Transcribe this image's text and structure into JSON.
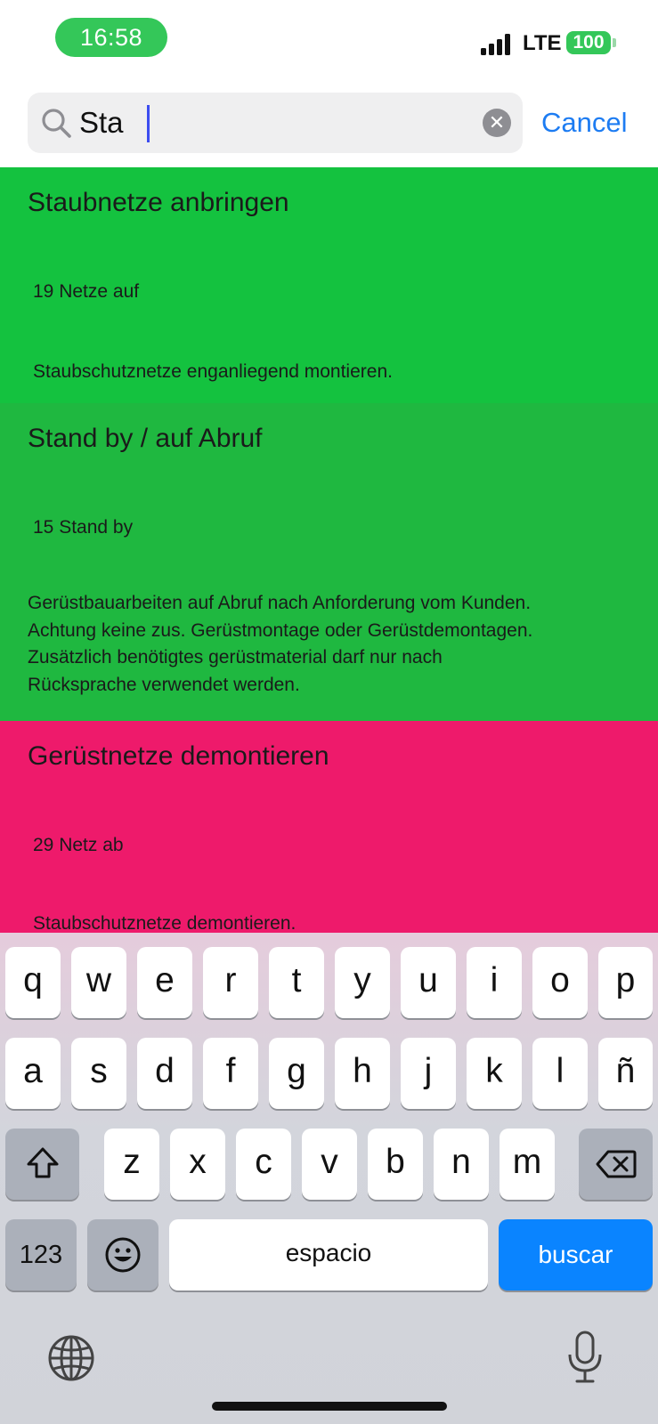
{
  "status_bar": {
    "time": "16:58",
    "network": "LTE",
    "battery": "100",
    "time_pill_color": "#34c759"
  },
  "search": {
    "query": "Sta",
    "cancel_label": "Cancel",
    "icons": [
      "search-icon",
      "clear-icon"
    ]
  },
  "results": [
    {
      "title": "Staubnetze anbringen",
      "code": "19 Netze auf",
      "description": "Staubschutznetze enganliegend montieren.",
      "color": "#14c23f"
    },
    {
      "title": "Stand by / auf Abruf",
      "code": "15 Stand by",
      "description": "Gerüstbauarbeiten auf Abruf nach Anforderung vom Kunden.\nAchtung keine zus. Gerüstmontage oder Gerüstdemontagen.\nZusätzlich benötigtes gerüstmaterial darf nur nach\nRücksprache verwendet werden.",
      "color": "#1fb840"
    },
    {
      "title": "Gerüstnetze demontieren",
      "code": "29 Netz ab",
      "description": "Staubschutznetze demontieren.",
      "color": "#ee1a6b"
    }
  ],
  "keyboard": {
    "row1": [
      "q",
      "w",
      "e",
      "r",
      "t",
      "y",
      "u",
      "i",
      "o",
      "p"
    ],
    "row2": [
      "a",
      "s",
      "d",
      "f",
      "g",
      "h",
      "j",
      "k",
      "l",
      "ñ"
    ],
    "row3": [
      "z",
      "x",
      "c",
      "v",
      "b",
      "n",
      "m"
    ],
    "numbers_label": "123",
    "space_label": "espacio",
    "action_label": "buscar",
    "action_color": "#0a84ff",
    "icons": [
      "shift-icon",
      "backspace-icon",
      "emoji-icon",
      "globe-icon",
      "microphone-icon"
    ]
  }
}
